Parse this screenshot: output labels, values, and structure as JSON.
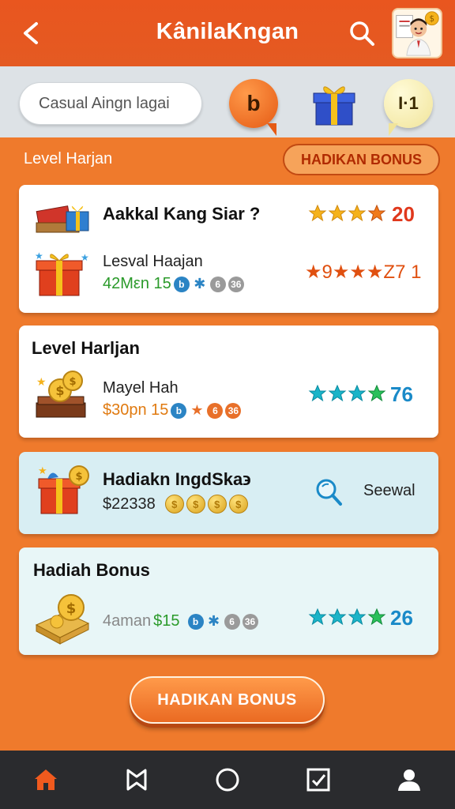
{
  "header": {
    "title": "KânilaKngan",
    "back_icon": "chevron-left-icon",
    "search_icon": "search-icon",
    "avatar_icon": "user-avatar-icon"
  },
  "top_bar": {
    "search_placeholder": "Casual Aingn lagai",
    "bubble_left_label": "b",
    "bubble_right_label": "I·1",
    "gift_icon": "gift-icon"
  },
  "section": {
    "label": "Level Harjan",
    "bonus_button": "HADIKAN BONUS"
  },
  "cards": [
    {
      "title": "Aakkal Kang Siar ?",
      "score": "20",
      "subtitle": "Lesval Haajan",
      "detail": "42Mεn 15",
      "score2": "★9★★★Z7 1"
    },
    {
      "title": "Level Harljan",
      "subtitle": "Mayel Hah",
      "detail": "$30pn 15",
      "score": "76"
    },
    {
      "title": "Hadiakn IngdSka϶",
      "amount": "$22338",
      "action": "Seewal"
    },
    {
      "title": "Hadiah Bonus",
      "detail_gray": "4aman",
      "detail_green": "$15",
      "score": "26"
    }
  ],
  "cta": {
    "label": "HADIKAN BONUS"
  },
  "nav": {
    "items": [
      "home-icon",
      "bookmark-icon",
      "circle-icon",
      "checklist-icon",
      "profile-icon"
    ]
  },
  "colors": {
    "header": "#e9561f",
    "background": "#ef7a2c",
    "star_gold": "#f5b21b",
    "star_teal": "#1ab4c8"
  }
}
